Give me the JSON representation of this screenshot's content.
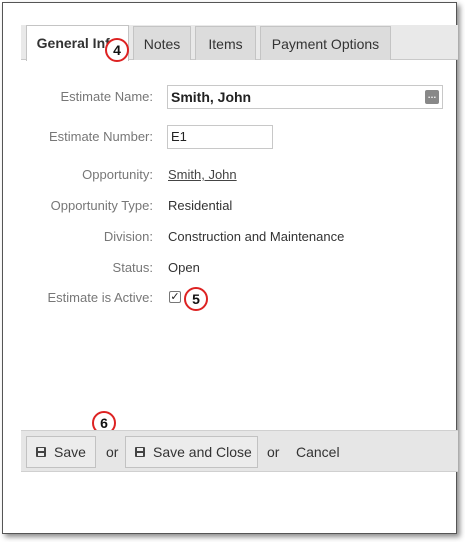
{
  "tabs": [
    {
      "label": "General Info",
      "active": true
    },
    {
      "label": "Notes",
      "active": false
    },
    {
      "label": "Items",
      "active": false
    },
    {
      "label": "Payment Options",
      "active": false
    }
  ],
  "form": {
    "estimate_name": {
      "label": "Estimate Name:",
      "value": "Smith, John"
    },
    "estimate_number": {
      "label": "Estimate Number:",
      "value": "E1"
    },
    "opportunity": {
      "label": "Opportunity:",
      "value": "Smith, John"
    },
    "opportunity_type": {
      "label": "Opportunity Type:",
      "value": "Residential"
    },
    "division": {
      "label": "Division:",
      "value": "Construction and Maintenance"
    },
    "status": {
      "label": "Status:",
      "value": "Open"
    },
    "estimate_active": {
      "label": "Estimate is Active:",
      "checked": true
    }
  },
  "footer": {
    "save_label": "Save",
    "or_1": "or",
    "save_close_label": "Save and Close",
    "or_2": "or",
    "cancel_label": "Cancel"
  },
  "callouts": {
    "c4": "4",
    "c5": "5",
    "c6": "6"
  },
  "colors": {
    "callout_ring": "#dd2222",
    "tab_bg": "#dcdcdc",
    "footer_bg": "#e6e6e6"
  }
}
